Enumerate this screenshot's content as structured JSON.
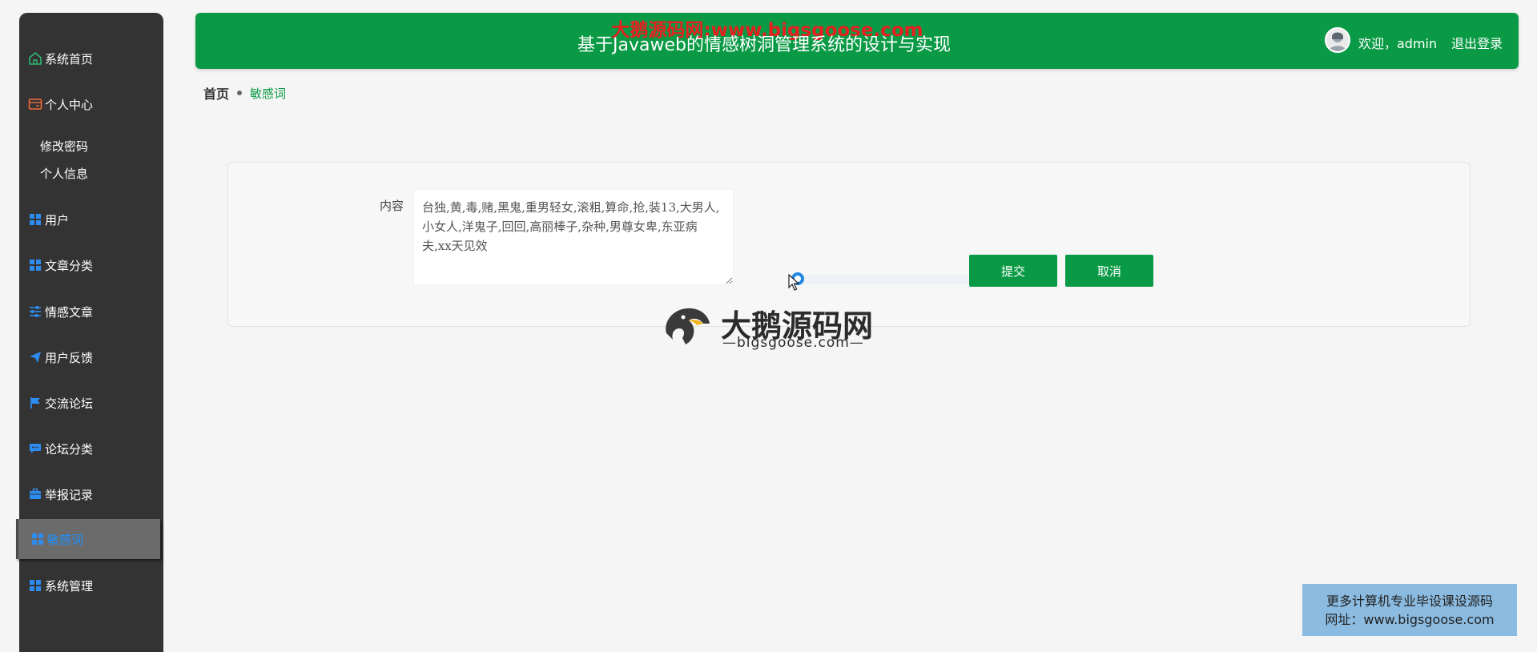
{
  "header": {
    "watermark": "大鹅源码网:www.bigsgoose.com",
    "title": "基于Javaweb的情感树洞管理系统的设计与实现",
    "welcome": "欢迎，admin",
    "logout": "退出登录"
  },
  "sidebar": {
    "items": [
      {
        "label": "系统首页",
        "icon": "home-icon"
      },
      {
        "label": "个人中心",
        "icon": "id-card-icon"
      },
      {
        "label": "修改密码"
      },
      {
        "label": "个人信息"
      },
      {
        "label": "用户",
        "icon": "grid-icon"
      },
      {
        "label": "文章分类",
        "icon": "grid-icon"
      },
      {
        "label": "情感文章",
        "icon": "sliders-icon"
      },
      {
        "label": "用户反馈",
        "icon": "paper-plane-icon"
      },
      {
        "label": "交流论坛",
        "icon": "flag-icon"
      },
      {
        "label": "论坛分类",
        "icon": "chat-icon"
      },
      {
        "label": "举报记录",
        "icon": "briefcase-icon"
      },
      {
        "label": "敏感词",
        "icon": "grid-icon",
        "active": true
      },
      {
        "label": "系统管理",
        "icon": "grid-icon"
      }
    ]
  },
  "breadcrumb": {
    "home": "首页",
    "current": "敏感词"
  },
  "form": {
    "label": "内容",
    "value": "台独,黄,毒,赌,黑鬼,重男轻女,滚粗,算命,抢,装13,大男人,小女人,洋鬼子,回回,高丽棒子,杂种,男尊女卑,东亚病夫,xx天见效",
    "submit": "提交",
    "cancel": "取消"
  },
  "logo": {
    "brand": "大鹅源码网",
    "sub": "—bigsgoose.com—"
  },
  "promo": {
    "line1": "更多计算机专业毕设课设源码",
    "line2": "网址：www.bigsgoose.com"
  },
  "colors": {
    "primary": "#0a9a45",
    "sidebar": "#333333",
    "watermark": "#e62020",
    "active_text": "#1e90ff"
  }
}
